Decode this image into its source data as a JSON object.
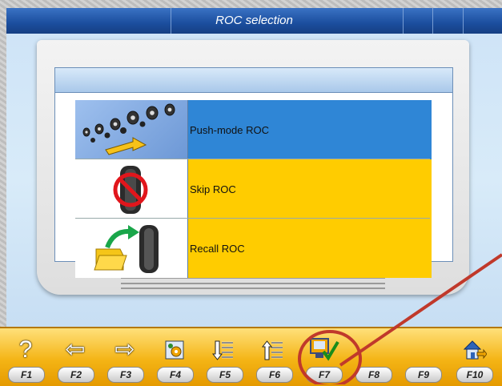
{
  "window": {
    "title": "ROC selection"
  },
  "options": [
    {
      "label": "Push-mode ROC",
      "icon": "push-mode-roc-icon",
      "selected": true
    },
    {
      "label": "Skip ROC",
      "icon": "skip-roc-icon",
      "selected": false
    },
    {
      "label": "Recall ROC",
      "icon": "recall-roc-icon",
      "selected": false
    }
  ],
  "toolbar": {
    "keys": [
      {
        "label": "F1",
        "icon": "help-icon"
      },
      {
        "label": "F2",
        "icon": "arrow-left-icon"
      },
      {
        "label": "F3",
        "icon": "arrow-right-icon"
      },
      {
        "label": "F4",
        "icon": "settings-gear-icon"
      },
      {
        "label": "F5",
        "icon": "list-down-icon"
      },
      {
        "label": "F6",
        "icon": "list-up-icon"
      },
      {
        "label": "F7",
        "icon": "confirm-check-icon"
      },
      {
        "label": "F8",
        "icon": ""
      },
      {
        "label": "F9",
        "icon": ""
      },
      {
        "label": "F10",
        "icon": "home-exit-icon"
      }
    ]
  },
  "colors": {
    "selected_row": "#2f86d6",
    "unselected_row": "#ffcc00",
    "toolbar": "#f4b415",
    "annotation": "#c0392b"
  }
}
